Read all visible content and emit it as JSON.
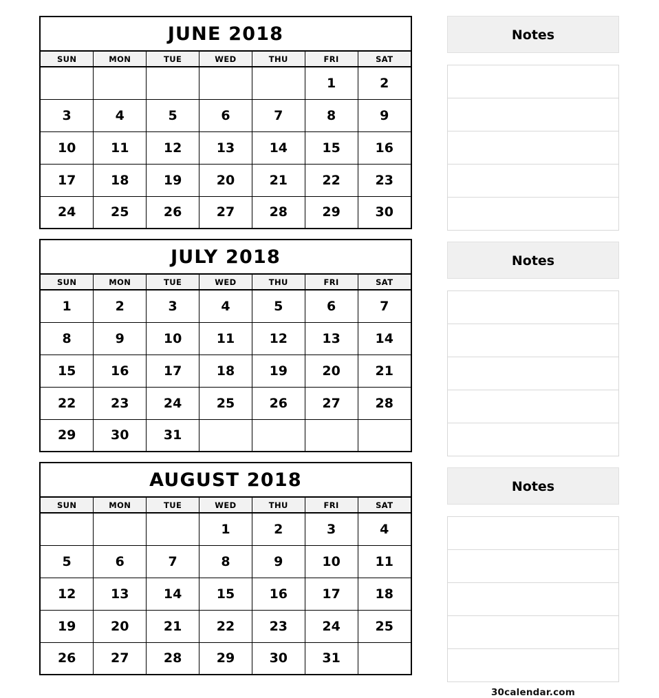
{
  "weekdays": [
    "SUN",
    "MON",
    "TUE",
    "WED",
    "THU",
    "FRI",
    "SAT"
  ],
  "months": [
    {
      "title": "JUNE 2018",
      "weeks": [
        [
          "",
          "",
          "",
          "",
          "",
          "1",
          "2"
        ],
        [
          "3",
          "4",
          "5",
          "6",
          "7",
          "8",
          "9"
        ],
        [
          "10",
          "11",
          "12",
          "13",
          "14",
          "15",
          "16"
        ],
        [
          "17",
          "18",
          "19",
          "20",
          "21",
          "22",
          "23"
        ],
        [
          "24",
          "25",
          "26",
          "27",
          "28",
          "29",
          "30"
        ]
      ]
    },
    {
      "title": "JULY 2018",
      "weeks": [
        [
          "1",
          "2",
          "3",
          "4",
          "5",
          "6",
          "7"
        ],
        [
          "8",
          "9",
          "10",
          "11",
          "12",
          "13",
          "14"
        ],
        [
          "15",
          "16",
          "17",
          "18",
          "19",
          "20",
          "21"
        ],
        [
          "22",
          "23",
          "24",
          "25",
          "26",
          "27",
          "28"
        ],
        [
          "29",
          "30",
          "31",
          "",
          "",
          "",
          ""
        ]
      ]
    },
    {
      "title": "AUGUST 2018",
      "weeks": [
        [
          "",
          "",
          "",
          "1",
          "2",
          "3",
          "4"
        ],
        [
          "5",
          "6",
          "7",
          "8",
          "9",
          "10",
          "11"
        ],
        [
          "12",
          "13",
          "14",
          "15",
          "16",
          "17",
          "18"
        ],
        [
          "19",
          "20",
          "21",
          "22",
          "23",
          "24",
          "25"
        ],
        [
          "26",
          "27",
          "28",
          "29",
          "30",
          "31",
          ""
        ]
      ]
    }
  ],
  "notes": [
    {
      "title": "Notes",
      "lines": [
        "",
        "",
        "",
        "",
        ""
      ]
    },
    {
      "title": "Notes",
      "lines": [
        "",
        "",
        "",
        "",
        ""
      ]
    },
    {
      "title": "Notes",
      "lines": [
        "",
        "",
        "",
        "",
        ""
      ]
    }
  ],
  "credit": "30calendar.com",
  "colors": {
    "grid_line": "#000000",
    "weekday_band": "#f2f2f2",
    "notes_header_bg": "#f0f0f0",
    "notes_line": "#d8d8d8"
  }
}
